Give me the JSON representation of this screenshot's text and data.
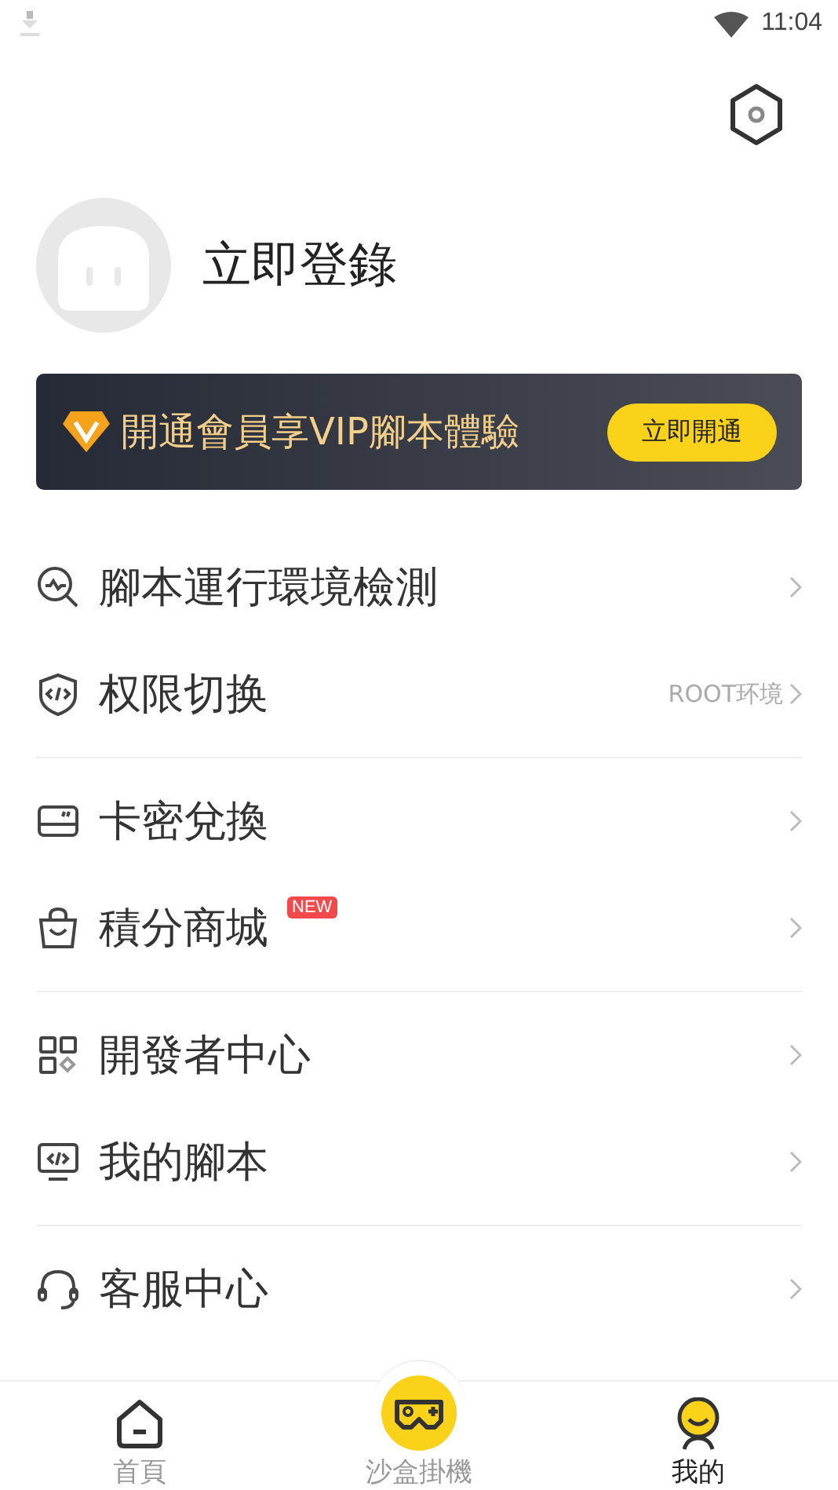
{
  "status_bar": {
    "time": "11:04"
  },
  "profile": {
    "name": "立即登錄"
  },
  "vip_banner": {
    "text": "開通會員享VIP腳本體驗",
    "button": "立即開通"
  },
  "menu_groups": [
    [
      {
        "label": "腳本運行環境檢測"
      },
      {
        "label": "权限切换",
        "value": "ROOT环境"
      }
    ],
    [
      {
        "label": "卡密兌換"
      },
      {
        "label": "積分商城",
        "badge": "NEW"
      }
    ],
    [
      {
        "label": "開發者中心"
      },
      {
        "label": "我的腳本"
      }
    ],
    [
      {
        "label": "客服中心"
      }
    ]
  ],
  "tabs": [
    {
      "label": "首頁",
      "selected": false
    },
    {
      "label": "沙盒掛機",
      "selected": false
    },
    {
      "label": "我的",
      "selected": true
    }
  ]
}
